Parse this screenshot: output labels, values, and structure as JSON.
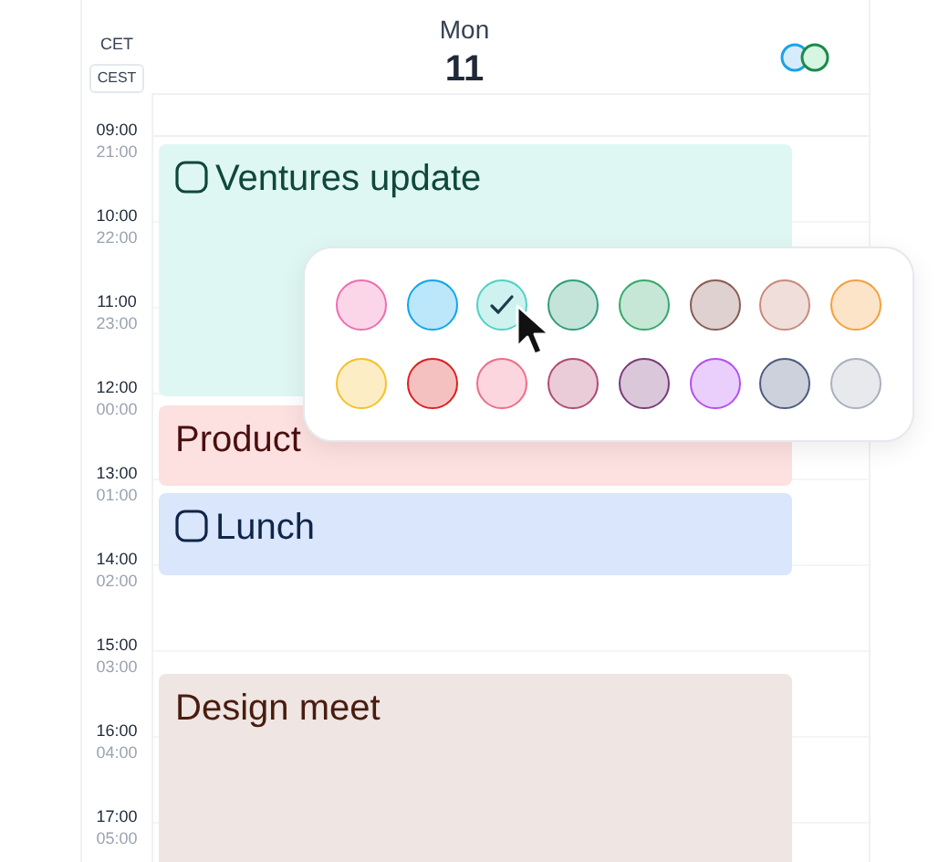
{
  "header": {
    "timezone_primary": "CET",
    "timezone_secondary": "CEST",
    "weekday": "Mon",
    "day": "11"
  },
  "hours": [
    {
      "primary": "09:00",
      "secondary": "21:00"
    },
    {
      "primary": "10:00",
      "secondary": "22:00"
    },
    {
      "primary": "11:00",
      "secondary": "23:00"
    },
    {
      "primary": "12:00",
      "secondary": "00:00"
    },
    {
      "primary": "13:00",
      "secondary": "01:00"
    },
    {
      "primary": "14:00",
      "secondary": "02:00"
    },
    {
      "primary": "15:00",
      "secondary": "03:00"
    },
    {
      "primary": "16:00",
      "secondary": "04:00"
    },
    {
      "primary": "17:00",
      "secondary": "05:00"
    }
  ],
  "events": [
    {
      "title": "Ventures update",
      "kind": "task",
      "color": "#dff7f2"
    },
    {
      "title": "Product",
      "kind": "event",
      "color": "#fde0e0"
    },
    {
      "title": "Lunch",
      "kind": "task",
      "color": "#d9e6fb"
    },
    {
      "title": "Design meet",
      "kind": "event",
      "color": "#efe5e2"
    }
  ],
  "color_picker": {
    "swatches": [
      {
        "color": "#f06cb0",
        "selected": false
      },
      {
        "color": "#0ea5e9",
        "selected": false
      },
      {
        "color": "#4fd1c5",
        "selected": true
      },
      {
        "color": "#2e9d7b",
        "selected": false
      },
      {
        "color": "#35a86a",
        "selected": false
      },
      {
        "color": "#8a5a55",
        "selected": false
      },
      {
        "color": "#c98a7d",
        "selected": false
      },
      {
        "color": "#f59e3c",
        "selected": false
      },
      {
        "color": "#f5c02b",
        "selected": false
      },
      {
        "color": "#dc1f1f",
        "selected": false
      },
      {
        "color": "#f06c8a",
        "selected": false
      },
      {
        "color": "#b04a72",
        "selected": false
      },
      {
        "color": "#7a3a7a",
        "selected": false
      },
      {
        "color": "#b44ff0",
        "selected": false
      },
      {
        "color": "#4e5a80",
        "selected": false
      },
      {
        "color": "#a8b0bf",
        "selected": false
      }
    ]
  }
}
